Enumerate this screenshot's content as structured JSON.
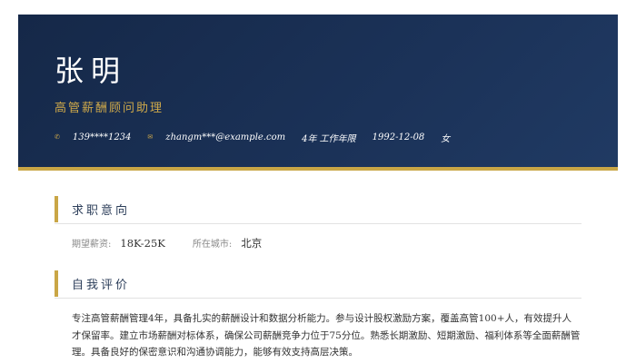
{
  "header": {
    "name": "张明",
    "title": "高管薪酬顾问助理",
    "contacts": {
      "phone_icon": "phone-icon",
      "phone": "139****1234",
      "email_icon": "email-icon",
      "email": "zhangm***@example.com",
      "experience": "4年 工作年限",
      "birthday": "1992-12-08",
      "gender": "女"
    }
  },
  "sections": {
    "intent": {
      "title": "求职意向",
      "salary_label": "期望薪资:",
      "salary_value": "18K-25K",
      "city_label": "所在城市:",
      "city_value": "北京"
    },
    "summary": {
      "title": "自我评价",
      "text": "专注高管薪酬管理4年，具备扎实的薪酬设计和数据分析能力。参与设计股权激励方案，覆盖高管100+人，有效提升人才保留率。建立市场薪酬对标体系，确保公司薪酬竞争力位于75分位。熟悉长期激励、短期激励、福利体系等全面薪酬管理。具备良好的保密意识和沟通协调能力，能够有效支持高层决策。"
    }
  },
  "colors": {
    "header_bg": "#1b3258",
    "accent_gold": "#c9a646",
    "title_gold": "#cfa94a"
  }
}
